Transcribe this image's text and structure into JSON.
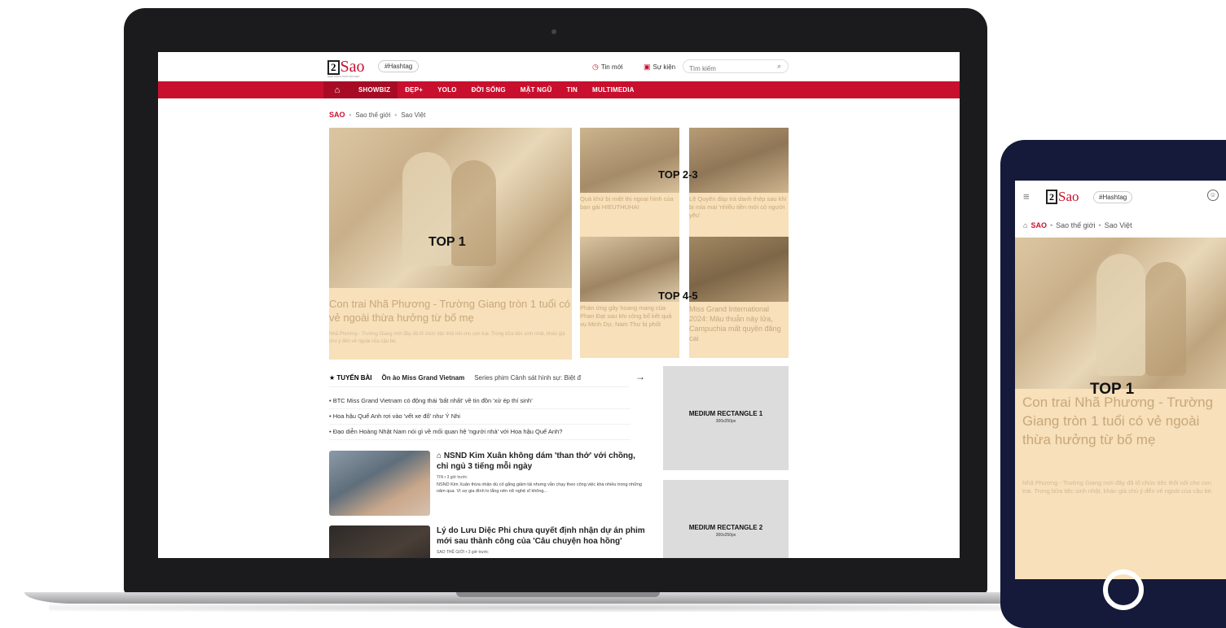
{
  "site": {
    "logo_num": "2",
    "logo_word": "Sao",
    "logo_sub": "NHỊP SỐNG NGÔI SAO ĐẸP",
    "hashtag": "#Hashtag"
  },
  "header": {
    "tin_moi": "Tin mới",
    "su_kien": "Sự kiện",
    "search_placeholder": "Tìm kiếm"
  },
  "nav": {
    "items": [
      "SHOWBIZ",
      "ĐẸP+",
      "YOLO",
      "ĐỜI SỐNG",
      "MẶT NGŨ",
      "TIN",
      "MULTIMEDIA"
    ]
  },
  "breadcrumb": {
    "main": "SAO",
    "items": [
      "Sao thế giới",
      "Sao Việt"
    ]
  },
  "hero": {
    "label": "TOP 1",
    "title": "Con trai Nhã Phương - Trường Giang tròn 1 tuổi có vẻ ngoài thừa hưởng từ bố mẹ",
    "sapo": "Nhã Phương - Trường Giang mới đây đã tổ chức tiệc thôi nôi cho con trai. Trong bữa tiệc sinh nhật, khán giả chú ý đến vẻ ngoài của cậu bé."
  },
  "top23": {
    "label": "TOP 2-3",
    "card1": "Quá khứ bị miệt thị ngoại hình của bạn gái HIEUTHUHAI",
    "card2": "Lệ Quyên đáp trả danh thép sau khi bị mỉa mai 'nhiều tiền mới có người yêu'"
  },
  "top45": {
    "label": "TOP 4-5",
    "card1": "Phản ứng gây hoang mang của Phan Đạt sau khi công bố kết quả vụ Minh Dự, Nam Thư bị phốt",
    "card2": "Miss Grand International 2024: Mâu thuẫn nảy lửa, Campuchia mất quyền đăng cai"
  },
  "tabs": {
    "featured": "TUYẾN BÀI",
    "selected": "Ồn ào Miss Grand Vietnam",
    "other": "Series phim Cảnh sát hình sự: Biệt đ"
  },
  "bullets": [
    "BTC Miss Grand Vietnam có động thái 'bất nhất' về tin đồn 'xử ép thí sinh'",
    "Hoa hậu Quế Anh rơi vào 'vết xe đổ' như Ý Nhi",
    "Đạo diễn Hoàng Nhật Nam nói gì về mối quan hệ 'người nhà' với Hoa hậu Quế Anh?"
  ],
  "news": [
    {
      "title": "NSND Kim Xuân không dám 'than thở' với chồng, chỉ ngủ 3 tiếng mỗi ngày",
      "meta": "TIN • 3 giờ trước",
      "sapo": "NSND Kim Xuân thừa nhận dù cố gắng giảm tải nhưng vẫn chạy theo công việc khá nhiều trong những năm qua. Vì sợ gia đình lo lắng nên nữ nghệ sĩ không..."
    },
    {
      "title": "Lý do Lưu Diệc Phi chưa quyết định nhận dự án phim mới sau thành công của 'Câu chuyện hoa hồng'",
      "meta": "SAO THẾ GIỚI • 3 giờ trước",
      "sapo": ""
    }
  ],
  "ads": [
    {
      "title": "MEDIUM RECTANGLE 1",
      "size": "300x250px"
    },
    {
      "title": "MEDIUM RECTANGLE 2",
      "size": "300x250px"
    }
  ],
  "mobile": {
    "hashtag": "#Hashtag",
    "bc_main": "SAO",
    "bc_items": [
      "Sao thế giới",
      "Sao Việt"
    ],
    "label": "TOP 1",
    "title": "Con trai Nhã Phương - Trường Giang tròn 1 tuổi có vẻ ngoài thừa hưởng từ bố mẹ",
    "sapo": "Nhã Phương - Trường Giang mới đây đã tổ chức tiệc thôi nôi cho con trai. Trong bữa tiệc sinh nhật, khán giả chú ý đến vẻ ngoài của cậu bé."
  },
  "colors": {
    "brand": "#c8102e",
    "overlay": "#f7e0ba",
    "phone_frame": "#151a3a"
  }
}
